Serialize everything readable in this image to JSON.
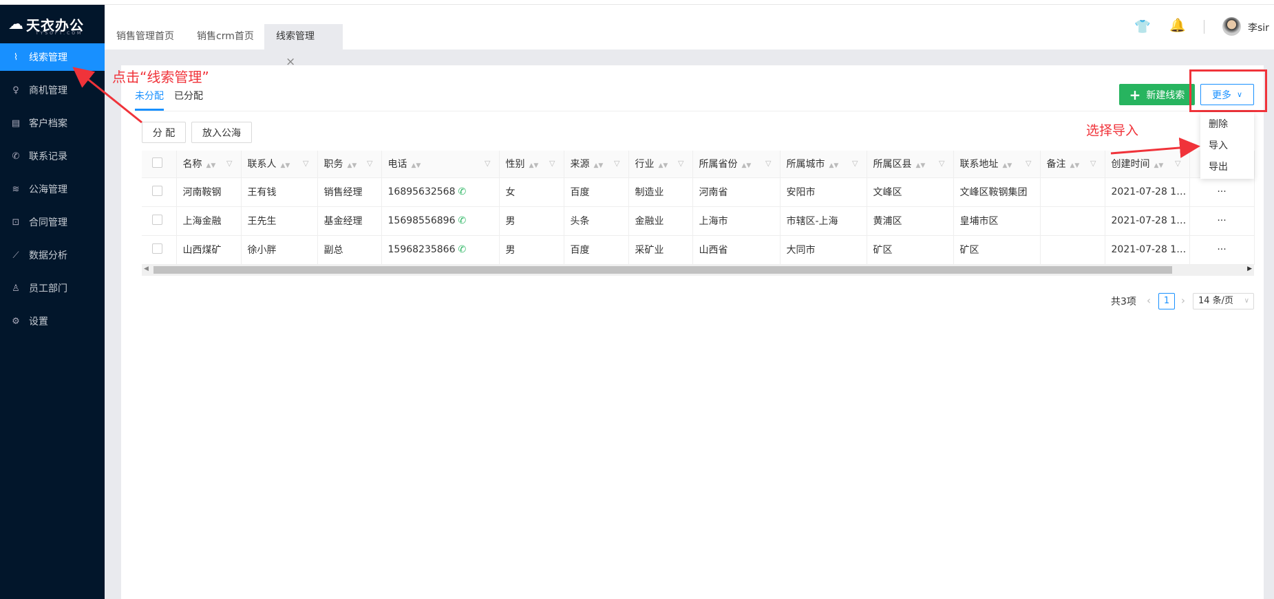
{
  "brand": {
    "name": "天衣办公",
    "sub": "TYSOFT.COM"
  },
  "sidebar": {
    "items": [
      {
        "label": "线索管理",
        "icon": "clue-icon",
        "glyph": "⌇"
      },
      {
        "label": "商机管理",
        "icon": "bulb-icon",
        "glyph": "♀"
      },
      {
        "label": "客户档案",
        "icon": "file-icon",
        "glyph": "▤"
      },
      {
        "label": "联系记录",
        "icon": "phone-icon",
        "glyph": "✆"
      },
      {
        "label": "公海管理",
        "icon": "waves-icon",
        "glyph": "≋"
      },
      {
        "label": "合同管理",
        "icon": "contract-icon",
        "glyph": "⊡"
      },
      {
        "label": "数据分析",
        "icon": "chart-icon",
        "glyph": "⟋"
      },
      {
        "label": "员工部门",
        "icon": "user-icon",
        "glyph": "♙"
      },
      {
        "label": "设置",
        "icon": "gear-icon",
        "glyph": "⚙"
      }
    ]
  },
  "tabs": [
    {
      "label": "销售管理首页"
    },
    {
      "label": "销售crm首页"
    },
    {
      "label": "线索管理",
      "close": "×"
    }
  ],
  "user": {
    "name": "李sir"
  },
  "subtabs": [
    {
      "label": "未分配"
    },
    {
      "label": "已分配"
    }
  ],
  "actions": {
    "assign": "分 配",
    "to_pool": "放入公海",
    "new": "新建线索",
    "new_icon": "+",
    "more": "更多"
  },
  "more_menu": [
    "删除",
    "导入",
    "导出"
  ],
  "table": {
    "columns": [
      "名称",
      "联系人",
      "职务",
      "电话",
      "性别",
      "来源",
      "行业",
      "所属省份",
      "所属城市",
      "所属区县",
      "联系地址",
      "备注",
      "创建时间"
    ],
    "rows": [
      [
        "河南鞍钢",
        "王有钱",
        "销售经理",
        "16895632568",
        "女",
        "百度",
        "制造业",
        "河南省",
        "安阳市",
        "文峰区",
        "文峰区鞍钢集团",
        "",
        "2021-07-28 16:..."
      ],
      [
        "上海金融",
        "王先生",
        "基金经理",
        "15698556896",
        "男",
        "头条",
        "金融业",
        "上海市",
        "市辖区-上海",
        "黄浦区",
        "皇埔市区",
        "",
        "2021-07-28 16:..."
      ],
      [
        "山西煤矿",
        "徐小胖",
        "副总",
        "15968235866",
        "男",
        "百度",
        "采矿业",
        "山西省",
        "大同市",
        "矿区",
        "矿区",
        "",
        "2021-07-28 16:..."
      ]
    ],
    "row_action": "···"
  },
  "pagination": {
    "total": "共3项",
    "current": "1",
    "page_size": "14 条/页"
  },
  "annotations": {
    "click": "点击“线索管理”",
    "select": "选择导入"
  },
  "colors": {
    "sidebar": "#02162b",
    "accent": "#1890ff",
    "green": "#27b45f",
    "annotation": "#f0333a"
  }
}
